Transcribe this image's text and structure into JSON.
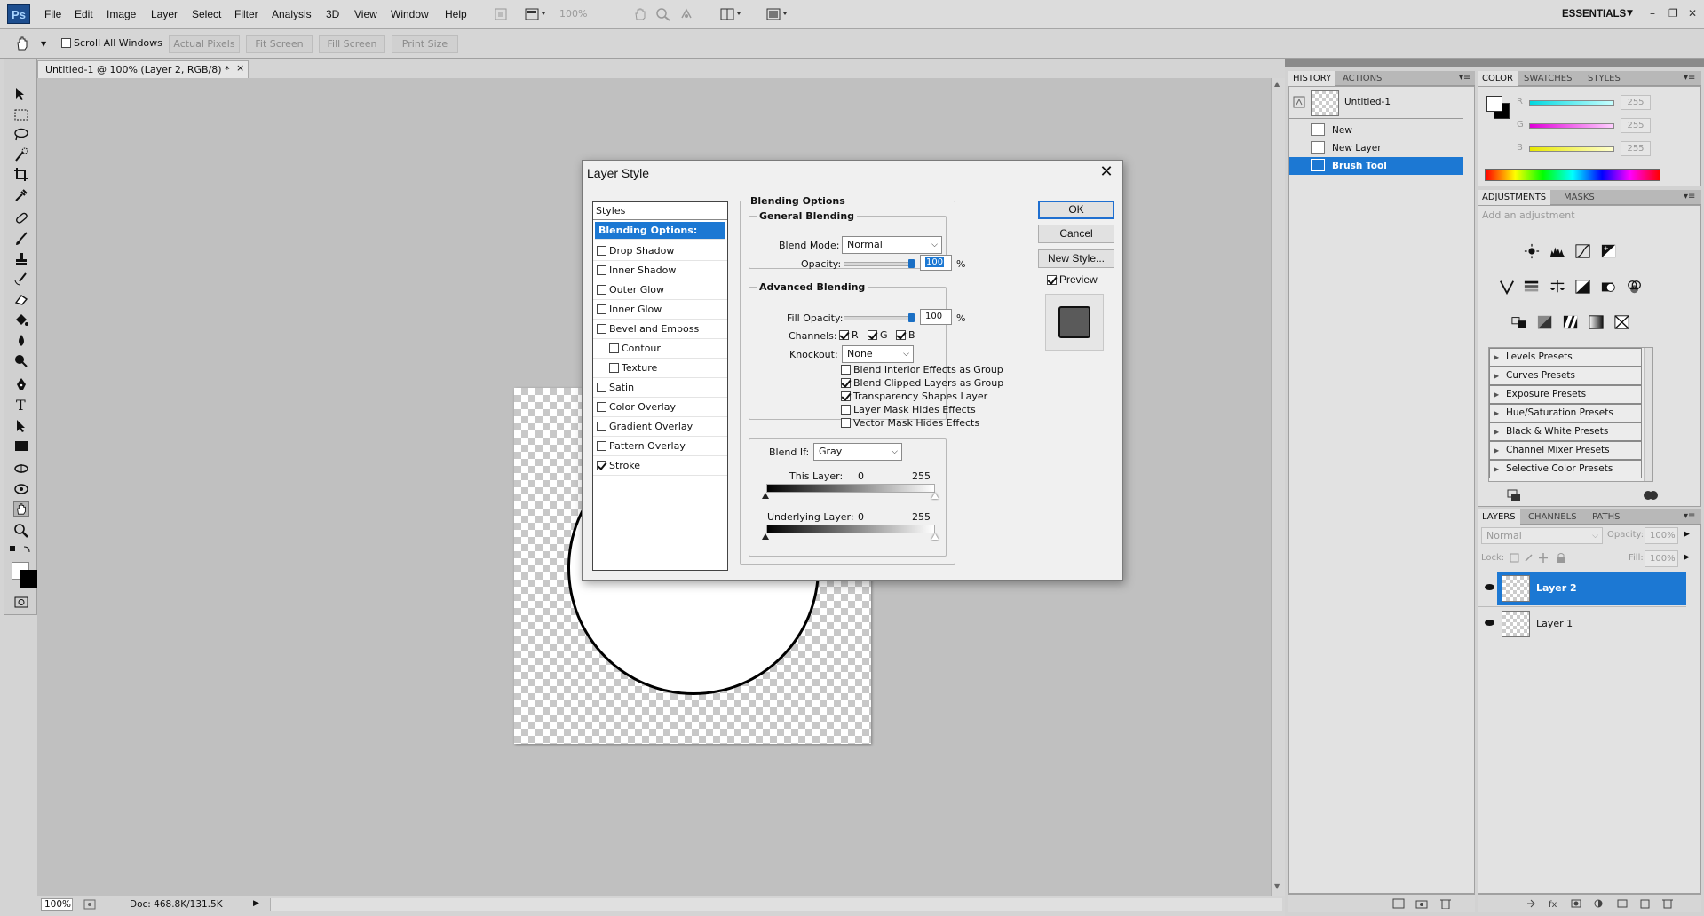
{
  "app": {
    "logo": "Ps",
    "menu": [
      "File",
      "Edit",
      "Image",
      "Layer",
      "Select",
      "Filter",
      "Analysis",
      "3D",
      "View",
      "Window",
      "Help"
    ],
    "zoom_menubar": "100%",
    "workspace": "ESSENTIALS",
    "workspace_caret": "▼",
    "window_controls": [
      "–",
      "❐",
      "✕"
    ]
  },
  "options_bar": {
    "scroll_all_windows": "Scroll All Windows",
    "buttons": [
      "Actual Pixels",
      "Fit Screen",
      "Fill Screen",
      "Print Size"
    ]
  },
  "document": {
    "tab_title": "Untitled-1 @ 100% (Layer 2, RGB/8) *",
    "tab_close": "×",
    "zoom": "100%",
    "doc_info": "Doc: 468.8K/131.5K",
    "status_arrow": "▶"
  },
  "history_panel": {
    "tabs": [
      "HISTORY",
      "ACTIONS"
    ],
    "snapshot": "Untitled-1",
    "items": [
      {
        "label": "New",
        "selected": false
      },
      {
        "label": "New Layer",
        "selected": false
      },
      {
        "label": "Brush Tool",
        "selected": true
      }
    ]
  },
  "color_panel": {
    "tabs": [
      "COLOR",
      "SWATCHES",
      "STYLES"
    ],
    "channels": [
      {
        "label": "R",
        "value": "255",
        "color": "#00d8e0"
      },
      {
        "label": "G",
        "value": "255",
        "color": "#e000d8"
      },
      {
        "label": "B",
        "value": "255",
        "color": "#e8e800"
      }
    ]
  },
  "adjustments_panel": {
    "tabs": [
      "ADJUSTMENTS",
      "MASKS"
    ],
    "hint": "Add an adjustment",
    "presets": [
      "Levels Presets",
      "Curves Presets",
      "Exposure Presets",
      "Hue/Saturation Presets",
      "Black & White Presets",
      "Channel Mixer Presets",
      "Selective Color Presets"
    ]
  },
  "layers_panel": {
    "tabs": [
      "LAYERS",
      "CHANNELS",
      "PATHS"
    ],
    "blend_mode": "Normal",
    "opacity_label": "Opacity:",
    "opacity": "100%",
    "lock_label": "Lock:",
    "fill_label": "Fill:",
    "fill": "100%",
    "layers": [
      {
        "name": "Layer 2",
        "selected": true
      },
      {
        "name": "Layer 1",
        "selected": false
      }
    ]
  },
  "dialog": {
    "title": "Layer Style",
    "close": "✕",
    "styles_header": "Styles",
    "styles": [
      {
        "label": "Blending Options: Default",
        "selected": true,
        "checkbox": false,
        "checked": false,
        "sub": false
      },
      {
        "label": "Drop Shadow",
        "checkbox": true,
        "checked": false,
        "sub": false
      },
      {
        "label": "Inner Shadow",
        "checkbox": true,
        "checked": false,
        "sub": false
      },
      {
        "label": "Outer Glow",
        "checkbox": true,
        "checked": false,
        "sub": false
      },
      {
        "label": "Inner Glow",
        "checkbox": true,
        "checked": false,
        "sub": false
      },
      {
        "label": "Bevel and Emboss",
        "checkbox": true,
        "checked": false,
        "sub": false
      },
      {
        "label": "Contour",
        "checkbox": true,
        "checked": false,
        "sub": true
      },
      {
        "label": "Texture",
        "checkbox": true,
        "checked": false,
        "sub": true
      },
      {
        "label": "Satin",
        "checkbox": true,
        "checked": false,
        "sub": false
      },
      {
        "label": "Color Overlay",
        "checkbox": true,
        "checked": false,
        "sub": false
      },
      {
        "label": "Gradient Overlay",
        "checkbox": true,
        "checked": false,
        "sub": false
      },
      {
        "label": "Pattern Overlay",
        "checkbox": true,
        "checked": false,
        "sub": false
      },
      {
        "label": "Stroke",
        "checkbox": true,
        "checked": true,
        "sub": false
      }
    ],
    "blending_options": "Blending Options",
    "general_blending": "General Blending",
    "blend_mode_label": "Blend Mode:",
    "blend_mode": "Normal",
    "opacity_label": "Opacity:",
    "opacity": "100",
    "percent": "%",
    "advanced_blending": "Advanced Blending",
    "fill_opacity_label": "Fill Opacity:",
    "fill_opacity": "100",
    "channels_label": "Channels:",
    "channels": [
      "R",
      "G",
      "B"
    ],
    "knockout_label": "Knockout:",
    "knockout": "None",
    "advanced_options": [
      {
        "label": "Blend Interior Effects as Group",
        "checked": false
      },
      {
        "label": "Blend Clipped Layers as Group",
        "checked": true
      },
      {
        "label": "Transparency Shapes Layer",
        "checked": true
      },
      {
        "label": "Layer Mask Hides Effects",
        "checked": false
      },
      {
        "label": "Vector Mask Hides Effects",
        "checked": false
      }
    ],
    "blend_if_label": "Blend If:",
    "blend_if": "Gray",
    "this_layer_label": "This Layer:",
    "this_layer_min": "0",
    "this_layer_max": "255",
    "underlying_label": "Underlying Layer:",
    "underlying_min": "0",
    "underlying_max": "255",
    "buttons": {
      "ok": "OK",
      "cancel": "Cancel",
      "new_style": "New Style..."
    },
    "preview_label": "Preview",
    "preview_checked": true
  }
}
